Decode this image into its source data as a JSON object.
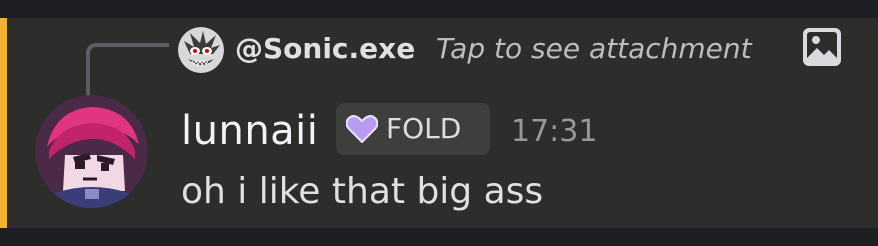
{
  "reply": {
    "author": "@Sonic.exe",
    "attachment_text": "Tap to see attachment",
    "attachment_icon": "image-icon"
  },
  "message": {
    "username": "lunnaii",
    "tag": {
      "label": "FOLD",
      "icon": "purple-heart-icon"
    },
    "timestamp": "17:31",
    "content": "oh i like that big ass"
  },
  "colors": {
    "accent_bar": "#f0b232",
    "message_background": "#2d2d2b",
    "page_background": "#1e1f22",
    "tag_heart": "#b99cf2"
  }
}
